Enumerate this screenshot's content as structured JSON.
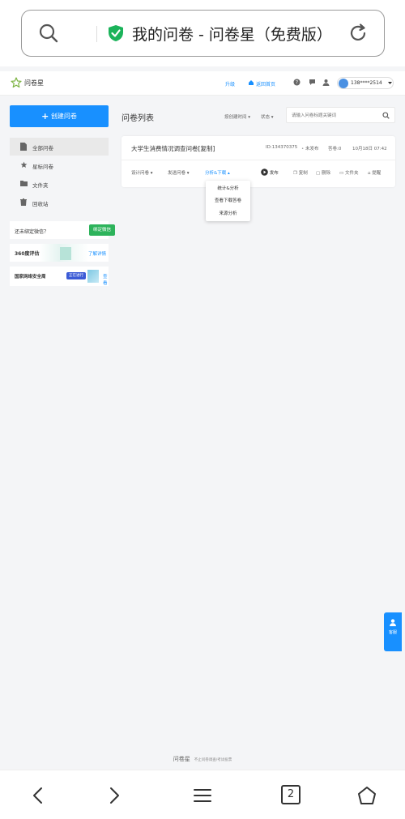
{
  "browser": {
    "url_title": "我的问卷 - 问卷星（免费版）",
    "tab_count": "2"
  },
  "header": {
    "logo_text": "问卷星",
    "upgrade_link": "升级",
    "home_link": "返回首页",
    "username": "138****2514"
  },
  "sidebar": {
    "create_label": "创建问卷",
    "items": [
      {
        "label": "全部问卷"
      },
      {
        "label": "星标问卷"
      },
      {
        "label": "文件夹"
      },
      {
        "label": "回收站"
      }
    ],
    "ad1_text": "还未绑定微信？",
    "ad1_button": "绑定微信",
    "ad2_text": "360度评估",
    "ad2_link": "了解详情",
    "ad3_text": "国家网络安全周",
    "ad3_badge": "正在进行",
    "ad3_link": "查看"
  },
  "main": {
    "list_title": "问卷列表",
    "sort_label": "按创建时间",
    "status_filter": "状态",
    "search_placeholder": "请输入问卷标题关键词"
  },
  "survey": {
    "title": "大学生消费情况调查问卷[复制]",
    "id": "ID:134370375",
    "status": "未发布",
    "answers": "答卷:0",
    "date": "10月18日 07:42",
    "action_design": "设计问卷",
    "action_send": "发送问卷",
    "action_analyze": "分析&下载",
    "action_publish": "发布",
    "action_copy": "复制",
    "action_delete": "删除",
    "action_folder": "文件夹",
    "action_remind": "提醒"
  },
  "dropdown": {
    "items": [
      "统计&分析",
      "查看下载答卷",
      "来源分析"
    ]
  },
  "float": {
    "label": "客服"
  },
  "footer": {
    "brand": "问卷星",
    "tagline": "不止问卷调查/考试投票"
  },
  "colors": {
    "primary": "#1890ff",
    "green": "#2db35b",
    "link": "#1890ff"
  }
}
